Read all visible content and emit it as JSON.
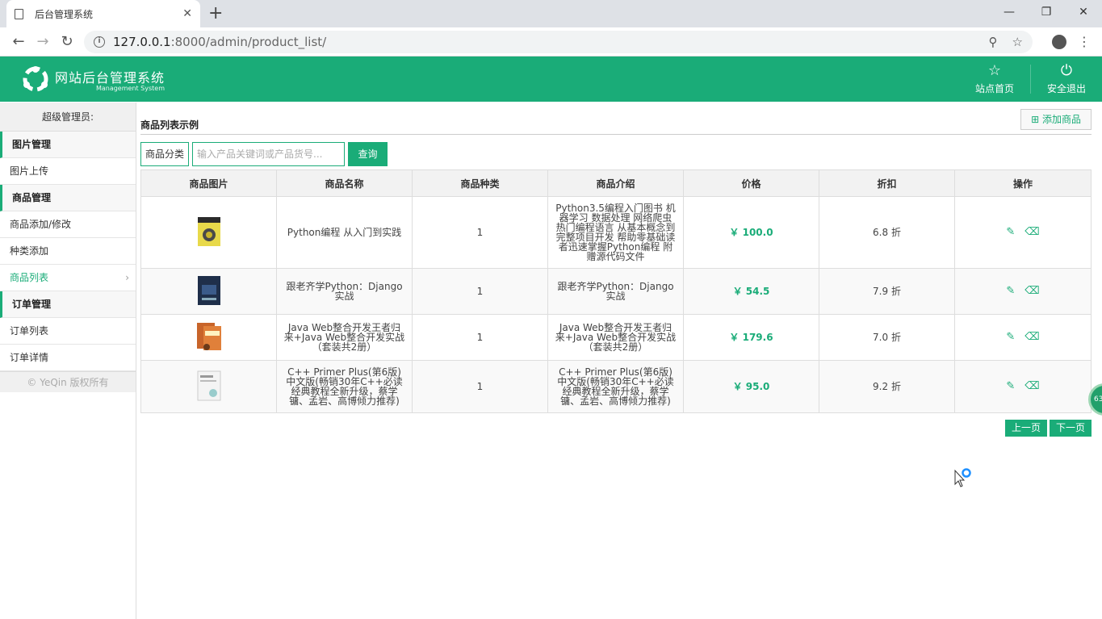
{
  "browser": {
    "tab_title": "后台管理系统",
    "url_host": "127.0.0.1",
    "url_path": ":8000/admin/product_list/"
  },
  "header": {
    "logo_title": "网站后台管理系统",
    "logo_subtitle": "Management System",
    "nav": [
      {
        "label": "站点首页",
        "icon": "star-icon"
      },
      {
        "label": "安全退出",
        "icon": "power-icon"
      }
    ]
  },
  "sidebar": {
    "admin_label": "超级管理员:",
    "groups": [
      {
        "title": "图片管理",
        "items": [
          "图片上传"
        ]
      },
      {
        "title": "商品管理",
        "items": [
          "商品添加/修改",
          "种类添加",
          "商品列表"
        ]
      },
      {
        "title": "订单管理",
        "items": [
          "订单列表",
          "订单详情"
        ]
      }
    ],
    "active_item": "商品列表",
    "copyright": "© YeQin 版权所有"
  },
  "main": {
    "page_title": "商品列表示例",
    "add_button": "添加商品",
    "search": {
      "category_label": "商品分类",
      "placeholder": "输入产品关键词或产品货号...",
      "button": "查询"
    },
    "table": {
      "headers": [
        "商品图片",
        "商品名称",
        "商品种类",
        "商品介绍",
        "价格",
        "折扣",
        "操作"
      ],
      "rows": [
        {
          "name": "Python编程 从入门到实践",
          "category": "1",
          "intro": "Python3.5编程入门图书 机器学习 数据处理 网络爬虫热门编程语言 从基本概念到完整项目开发 帮助零基础读者迅速掌握Python编程 附赠源代码文件",
          "price": "￥ 100.0",
          "discount": "6.8 折"
        },
        {
          "name": "跟老齐学Python：Django实战",
          "category": "1",
          "intro": "跟老齐学Python：Django实战",
          "price": "￥ 54.5",
          "discount": "7.9 折"
        },
        {
          "name": "Java Web整合开发王者归来+Java Web整合开发实战（套装共2册）",
          "category": "1",
          "intro": "Java Web整合开发王者归来+Java Web整合开发实战（套装共2册）",
          "price": "￥ 179.6",
          "discount": "7.0 折"
        },
        {
          "name": "C++ Primer Plus(第6版)中文版(畅销30年C++必读经典教程全新升级，蔡学镛、孟岩、高博倾力推荐)",
          "category": "1",
          "intro": "C++ Primer Plus(第6版)中文版(畅销30年C++必读经典教程全新升级，蔡学镛、孟岩、高博倾力推荐)",
          "price": "￥ 95.0",
          "discount": "9.2 折"
        }
      ]
    },
    "pager": {
      "prev": "上一页",
      "next": "下一页"
    }
  },
  "float_badge": "63",
  "colors": {
    "accent": "#1aac78"
  }
}
